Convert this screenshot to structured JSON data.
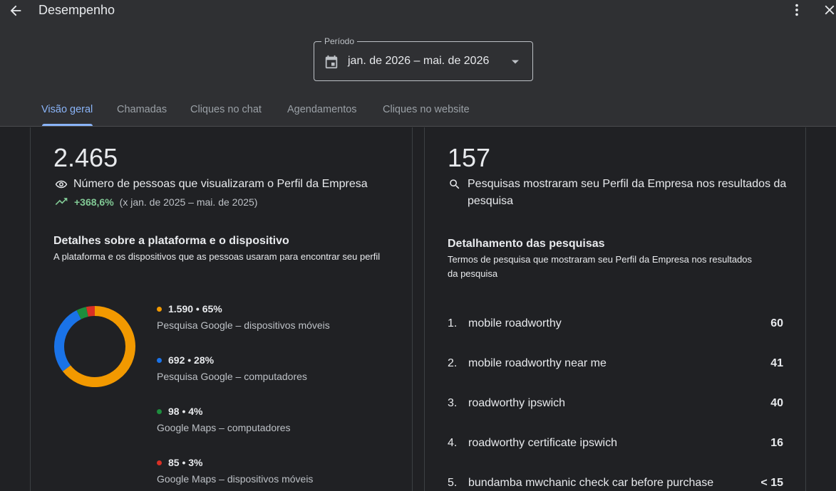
{
  "header": {
    "title": "Desempenho",
    "back_icon": "arrow-left-icon",
    "more_icon": "more-vert-icon",
    "close_icon": "close-icon"
  },
  "period": {
    "label": "Período",
    "value": "jan. de 2026 – mai. de 2026",
    "icon": "calendar-icon"
  },
  "tabs": [
    {
      "label": "Visão geral",
      "active": true
    },
    {
      "label": "Chamadas",
      "active": false
    },
    {
      "label": "Cliques no chat",
      "active": false
    },
    {
      "label": "Agendamentos",
      "active": false
    },
    {
      "label": "Cliques no website",
      "active": false
    }
  ],
  "profile_views": {
    "value": "2.465",
    "label": "Número de pessoas que visualizaram o Perfil da Empresa",
    "icon": "eye-icon",
    "trend_icon": "trending-up-icon",
    "trend_value": "+368,6%",
    "trend_range": "(x jan. de 2025 – mai. de 2025)"
  },
  "platform": {
    "title": "Detalhes sobre a plataforma e o dispositivo",
    "subtitle": "A plataforma e os dispositivos que as pessoas usaram para encontrar seu perfil",
    "items": [
      {
        "value": "1.590 • 65%",
        "label": "Pesquisa Google – dispositivos móveis",
        "color": "#f29900",
        "fraction": 0.645
      },
      {
        "value": "692 • 28%",
        "label": "Pesquisa Google – computadores",
        "color": "#1a73e8",
        "fraction": 0.281
      },
      {
        "value": "98 • 4%",
        "label": "Google Maps – computadores",
        "color": "#1e8e3e",
        "fraction": 0.04
      },
      {
        "value": "85 • 3%",
        "label": "Google Maps – dispositivos móveis",
        "color": "#d93025",
        "fraction": 0.034
      }
    ]
  },
  "searches": {
    "value": "157",
    "label": "Pesquisas mostraram seu Perfil da Empresa nos resultados da pesquisa",
    "icon": "search-icon",
    "title": "Detalhamento das pesquisas",
    "subtitle": "Termos de pesquisa que mostraram seu Perfil da Empresa nos resultados da pesquisa",
    "rows": [
      {
        "rank": "1.",
        "term": "mobile roadworthy",
        "count": "60"
      },
      {
        "rank": "2.",
        "term": "mobile roadworthy near me",
        "count": "41"
      },
      {
        "rank": "3.",
        "term": "roadworthy ipswich",
        "count": "40"
      },
      {
        "rank": "4.",
        "term": "roadworthy certificate ipswich",
        "count": "16"
      },
      {
        "rank": "5.",
        "term": "bundamba mwchanic check car before purchase",
        "count": "< 15"
      }
    ]
  }
}
